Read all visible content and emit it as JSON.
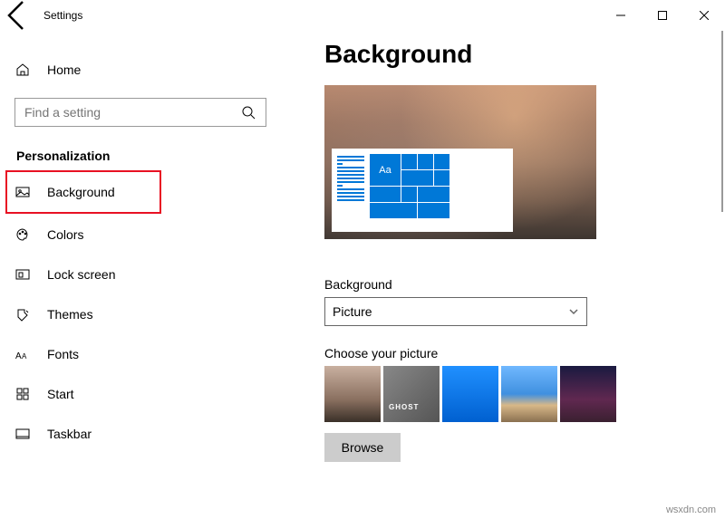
{
  "window": {
    "title": "Settings"
  },
  "sidebar": {
    "home": "Home",
    "search_placeholder": "Find a setting",
    "section": "Personalization",
    "items": [
      {
        "label": "Background"
      },
      {
        "label": "Colors"
      },
      {
        "label": "Lock screen"
      },
      {
        "label": "Themes"
      },
      {
        "label": "Fonts"
      },
      {
        "label": "Start"
      },
      {
        "label": "Taskbar"
      }
    ]
  },
  "main": {
    "heading": "Background",
    "preview_sample": "Aa",
    "bg_label": "Background",
    "bg_value": "Picture",
    "choose_label": "Choose your picture",
    "browse": "Browse"
  },
  "watermark": "wsxdn.com"
}
